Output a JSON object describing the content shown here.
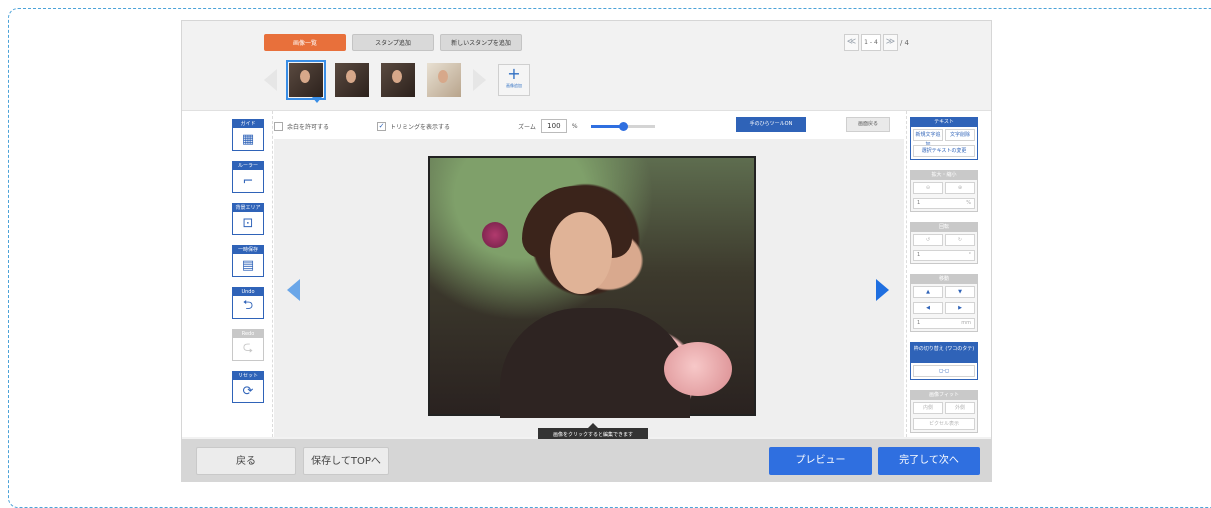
{
  "tabs": [
    "画像一覧",
    "スタンプ追加",
    "新しいスタンプを追加"
  ],
  "pager": {
    "prev": "≪",
    "current": "1 - 4",
    "next": "≫",
    "total": "/ 4"
  },
  "strip": {
    "add_label": "画像追加"
  },
  "left_tools": [
    {
      "label": "ガイド",
      "icon": "▦"
    },
    {
      "label": "ルーラー",
      "icon": "⌐"
    },
    {
      "label": "背景エリア",
      "icon": "⊡"
    },
    {
      "label": "一時保存",
      "icon": "▤"
    },
    {
      "label": "Undo",
      "icon": "⮌"
    },
    {
      "label": "Redo",
      "icon": "⮎"
    },
    {
      "label": "リセット",
      "icon": "⟳"
    }
  ],
  "options": {
    "allow_margin": "余白を許可する",
    "trimming": "トリミングを表示する",
    "zoom_label": "ズーム",
    "zoom_value": "100",
    "zoom_unit": "%",
    "zoom_level": 0.5,
    "guide_button": "手のひらツールON",
    "plain_button": "画面戻る"
  },
  "canvas": {
    "tooltip": "画像をクリックすると編集できます"
  },
  "right_panels": {
    "text": {
      "title": "テキスト",
      "add": "新規文字追加",
      "delete": "文字削除",
      "change": "選択テキストの変更"
    },
    "scale": {
      "title": "拡大・縮小",
      "value": "1",
      "unit": "%"
    },
    "rotate": {
      "title": "回転",
      "value": "1",
      "unit": "°"
    },
    "move": {
      "title": "移動",
      "value": "1",
      "unit": "mm"
    },
    "frame": {
      "title": "枠の切り替え (ワコのタテ)",
      "icon": "◻-◻"
    },
    "image_fit": {
      "title": "画像フィット",
      "inner": "内側",
      "outer": "外側",
      "fit": "ピクセル表示"
    }
  },
  "bottom": {
    "back": "戻る",
    "save_top": "保存してTOPへ",
    "preview": "プレビュー",
    "finish_next": "完了して次へ"
  },
  "colors": {
    "accent_blue": "#2f63b8",
    "primary_blue": "#2f6fe0",
    "tab_orange": "#e8703b"
  }
}
